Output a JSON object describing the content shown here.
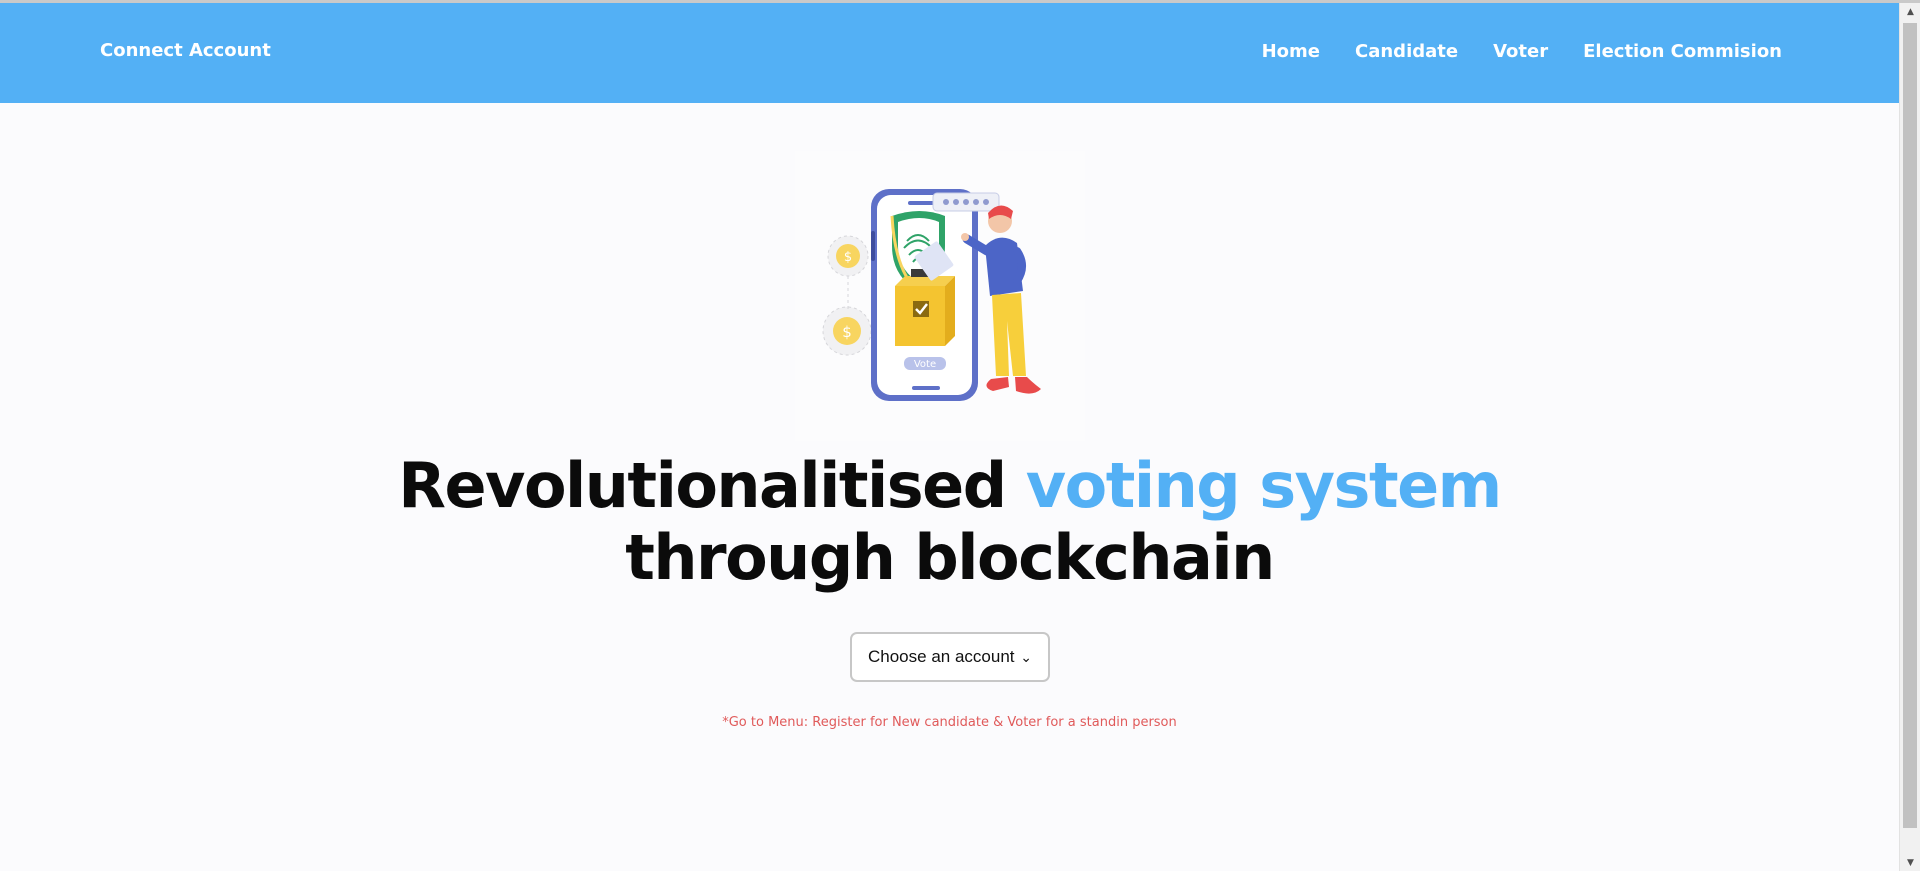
{
  "navbar": {
    "brand": "Connect Account",
    "links": [
      "Home",
      "Candidate",
      "Voter",
      "Election Commision"
    ],
    "bg_color": "#53b0f5"
  },
  "hero": {
    "headline_part1": "Revolutionalitised",
    "headline_accent": "voting system",
    "headline_part2": "through blockchain",
    "accent_color": "#53b0f5",
    "illustration_label": "Vote",
    "account_select": {
      "selected": "Choose an account"
    },
    "note": "*Go to Menu: Register for New candidate & Voter for a standin person"
  }
}
